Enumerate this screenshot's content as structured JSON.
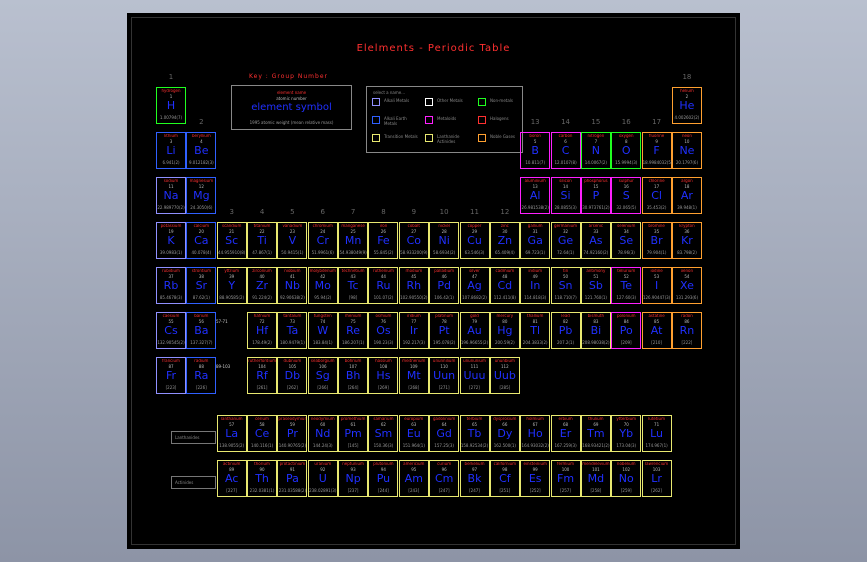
{
  "title": "Elelments - Periodic Table",
  "key": {
    "label": "Key : Group Number",
    "cell": {
      "name": "element name",
      "number": "atomic number",
      "symbol": "element symbol",
      "mass": "1995 atomic weight (mean relative mass)"
    },
    "legend_title": "select a name...",
    "legend": [
      {
        "label": "Alkali Metals",
        "color": "#9090ff"
      },
      {
        "label": "Other Metals",
        "color": "#ffffff"
      },
      {
        "label": "Non-metals",
        "color": "#20ff20"
      },
      {
        "label": "Alkali Earth Metals",
        "color": "#3060ff"
      },
      {
        "label": "Metaloids",
        "color": "#ff20ff"
      },
      {
        "label": "Halogens",
        "color": "#ff3030"
      },
      {
        "label": "Transition Metals",
        "color": "#e8e870"
      },
      {
        "label": "Lanthanide Actinides",
        "color": "#e8e870"
      },
      {
        "label": "Noble Gases",
        "color": "#ffa030"
      }
    ]
  },
  "groups": [
    "1",
    "2",
    "3",
    "4",
    "5",
    "6",
    "7",
    "8",
    "9",
    "10",
    "11",
    "12",
    "13",
    "14",
    "15",
    "16",
    "17",
    "18"
  ],
  "side_labels": [
    "57-71",
    "89-103"
  ],
  "buttons": {
    "lanthanide": "Lanthanides",
    "actinide": "Actinides"
  },
  "colors": {
    "alkali": "#9090ff",
    "alkaline": "#3060ff",
    "nonmetal": "#20ff20",
    "metalloid": "#ff20ff",
    "halogen": "#ff3030",
    "transition": "#e8e870",
    "noble": "#ffa030",
    "other": "#e8e870"
  },
  "elements": [
    {
      "n": "hydrogen",
      "z": "1",
      "s": "H",
      "m": "1.00794(7)",
      "r": 1,
      "c": 1,
      "t": "nonmetal"
    },
    {
      "n": "helium",
      "z": "2",
      "s": "He",
      "m": "4.002602(2)",
      "r": 1,
      "c": 18,
      "t": "noble"
    },
    {
      "n": "lithium",
      "z": "3",
      "s": "Li",
      "m": "6.941(2)",
      "r": 2,
      "c": 1,
      "t": "alkaline"
    },
    {
      "n": "beryllium",
      "z": "4",
      "s": "Be",
      "m": "9.012182(3)",
      "r": 2,
      "c": 2,
      "t": "alkaline"
    },
    {
      "n": "boron",
      "z": "5",
      "s": "B",
      "m": "10.811(7)",
      "r": 2,
      "c": 13,
      "t": "metalloid"
    },
    {
      "n": "carbon",
      "z": "6",
      "s": "C",
      "m": "12.0107(8)",
      "r": 2,
      "c": 14,
      "t": "metalloid"
    },
    {
      "n": "nitrogen",
      "z": "7",
      "s": "N",
      "m": "14.0067(2)",
      "r": 2,
      "c": 15,
      "t": "nonmetal"
    },
    {
      "n": "oxygen",
      "z": "8",
      "s": "O",
      "m": "15.9994(3)",
      "r": 2,
      "c": 16,
      "t": "nonmetal"
    },
    {
      "n": "fluorine",
      "z": "9",
      "s": "F",
      "m": "18.9984032(5)",
      "r": 2,
      "c": 17,
      "t": "noble"
    },
    {
      "n": "neon",
      "z": "10",
      "s": "Ne",
      "m": "20.1797(6)",
      "r": 2,
      "c": 18,
      "t": "noble"
    },
    {
      "n": "sodium",
      "z": "11",
      "s": "Na",
      "m": "22.989770(2)",
      "r": 3,
      "c": 1,
      "t": "alkali"
    },
    {
      "n": "magnesium",
      "z": "12",
      "s": "Mg",
      "m": "24.3050(6)",
      "r": 3,
      "c": 2,
      "t": "alkaline"
    },
    {
      "n": "aluminium",
      "z": "13",
      "s": "Al",
      "m": "26.981538(2)",
      "r": 3,
      "c": 13,
      "t": "metalloid"
    },
    {
      "n": "silicon",
      "z": "14",
      "s": "Si",
      "m": "28.0855(3)",
      "r": 3,
      "c": 14,
      "t": "metalloid"
    },
    {
      "n": "phosphorus",
      "z": "15",
      "s": "P",
      "m": "30.973761(2)",
      "r": 3,
      "c": 15,
      "t": "metalloid"
    },
    {
      "n": "sulphur",
      "z": "16",
      "s": "S",
      "m": "32.065(5)",
      "r": 3,
      "c": 16,
      "t": "metalloid"
    },
    {
      "n": "chlorine",
      "z": "17",
      "s": "Cl",
      "m": "35.453(2)",
      "r": 3,
      "c": 17,
      "t": "noble"
    },
    {
      "n": "argon",
      "z": "18",
      "s": "Ar",
      "m": "39.948(1)",
      "r": 3,
      "c": 18,
      "t": "noble"
    },
    {
      "n": "potassium",
      "z": "19",
      "s": "K",
      "m": "39.0983(1)",
      "r": 4,
      "c": 1,
      "t": "alkali"
    },
    {
      "n": "calcium",
      "z": "20",
      "s": "Ca",
      "m": "40.078(4)",
      "r": 4,
      "c": 2,
      "t": "alkaline"
    },
    {
      "n": "scandium",
      "z": "21",
      "s": "Sc",
      "m": "44.955910(8)",
      "r": 4,
      "c": 3,
      "t": "transition"
    },
    {
      "n": "titanium",
      "z": "22",
      "s": "Ti",
      "m": "47.867(1)",
      "r": 4,
      "c": 4,
      "t": "transition"
    },
    {
      "n": "vanadium",
      "z": "23",
      "s": "V",
      "m": "50.9415(1)",
      "r": 4,
      "c": 5,
      "t": "transition"
    },
    {
      "n": "chromium",
      "z": "24",
      "s": "Cr",
      "m": "51.9961(6)",
      "r": 4,
      "c": 6,
      "t": "transition"
    },
    {
      "n": "manganese",
      "z": "25",
      "s": "Mn",
      "m": "54.938049(9)",
      "r": 4,
      "c": 7,
      "t": "transition"
    },
    {
      "n": "iron",
      "z": "26",
      "s": "Fe",
      "m": "55.845(2)",
      "r": 4,
      "c": 8,
      "t": "transition"
    },
    {
      "n": "cobalt",
      "z": "27",
      "s": "Co",
      "m": "58.933200(9)",
      "r": 4,
      "c": 9,
      "t": "transition"
    },
    {
      "n": "nickel",
      "z": "28",
      "s": "Ni",
      "m": "58.6934(2)",
      "r": 4,
      "c": 10,
      "t": "transition"
    },
    {
      "n": "copper",
      "z": "29",
      "s": "Cu",
      "m": "63.546(3)",
      "r": 4,
      "c": 11,
      "t": "transition"
    },
    {
      "n": "zinc",
      "z": "30",
      "s": "Zn",
      "m": "65.409(4)",
      "r": 4,
      "c": 12,
      "t": "transition"
    },
    {
      "n": "gallium",
      "z": "31",
      "s": "Ga",
      "m": "69.723(1)",
      "r": 4,
      "c": 13,
      "t": "transition"
    },
    {
      "n": "germanium",
      "z": "32",
      "s": "Ge",
      "m": "72.64(1)",
      "r": 4,
      "c": 14,
      "t": "transition"
    },
    {
      "n": "arsenic",
      "z": "33",
      "s": "As",
      "m": "74.92160(2)",
      "r": 4,
      "c": 15,
      "t": "transition"
    },
    {
      "n": "selenium",
      "z": "34",
      "s": "Se",
      "m": "78.96(3)",
      "r": 4,
      "c": 16,
      "t": "transition"
    },
    {
      "n": "bromine",
      "z": "35",
      "s": "Br",
      "m": "79.904(1)",
      "r": 4,
      "c": 17,
      "t": "noble"
    },
    {
      "n": "krypton",
      "z": "36",
      "s": "Kr",
      "m": "83.798(2)",
      "r": 4,
      "c": 18,
      "t": "noble"
    },
    {
      "n": "rubidium",
      "z": "37",
      "s": "Rb",
      "m": "85.4678(3)",
      "r": 5,
      "c": 1,
      "t": "alkali"
    },
    {
      "n": "strontium",
      "z": "38",
      "s": "Sr",
      "m": "87.62(1)",
      "r": 5,
      "c": 2,
      "t": "alkaline"
    },
    {
      "n": "yttrium",
      "z": "39",
      "s": "Y",
      "m": "88.90585(2)",
      "r": 5,
      "c": 3,
      "t": "transition"
    },
    {
      "n": "zirconium",
      "z": "40",
      "s": "Zr",
      "m": "91.224(2)",
      "r": 5,
      "c": 4,
      "t": "transition"
    },
    {
      "n": "niobium",
      "z": "41",
      "s": "Nb",
      "m": "92.90638(2)",
      "r": 5,
      "c": 5,
      "t": "transition"
    },
    {
      "n": "molybdenum",
      "z": "42",
      "s": "Mo",
      "m": "95.94(2)",
      "r": 5,
      "c": 6,
      "t": "transition"
    },
    {
      "n": "technetium",
      "z": "43",
      "s": "Tc",
      "m": "[98]",
      "r": 5,
      "c": 7,
      "t": "transition"
    },
    {
      "n": "ruthenium",
      "z": "44",
      "s": "Ru",
      "m": "101.07(2)",
      "r": 5,
      "c": 8,
      "t": "transition"
    },
    {
      "n": "rhodium",
      "z": "45",
      "s": "Rh",
      "m": "102.90550(2)",
      "r": 5,
      "c": 9,
      "t": "transition"
    },
    {
      "n": "palladium",
      "z": "46",
      "s": "Pd",
      "m": "106.42(1)",
      "r": 5,
      "c": 10,
      "t": "transition"
    },
    {
      "n": "silver",
      "z": "47",
      "s": "Ag",
      "m": "107.8682(2)",
      "r": 5,
      "c": 11,
      "t": "transition"
    },
    {
      "n": "cadmium",
      "z": "48",
      "s": "Cd",
      "m": "112.411(8)",
      "r": 5,
      "c": 12,
      "t": "transition"
    },
    {
      "n": "indium",
      "z": "49",
      "s": "In",
      "m": "114.818(3)",
      "r": 5,
      "c": 13,
      "t": "transition"
    },
    {
      "n": "tin",
      "z": "50",
      "s": "Sn",
      "m": "118.710(7)",
      "r": 5,
      "c": 14,
      "t": "transition"
    },
    {
      "n": "antimony",
      "z": "51",
      "s": "Sb",
      "m": "121.760(1)",
      "r": 5,
      "c": 15,
      "t": "transition"
    },
    {
      "n": "tellurium",
      "z": "52",
      "s": "Te",
      "m": "127.60(3)",
      "r": 5,
      "c": 16,
      "t": "metalloid"
    },
    {
      "n": "iodine",
      "z": "53",
      "s": "I",
      "m": "126.90447(3)",
      "r": 5,
      "c": 17,
      "t": "noble"
    },
    {
      "n": "xenon",
      "z": "54",
      "s": "Xe",
      "m": "131.293(6)",
      "r": 5,
      "c": 18,
      "t": "noble"
    },
    {
      "n": "caesium",
      "z": "55",
      "s": "Cs",
      "m": "132.90545(2)",
      "r": 6,
      "c": 1,
      "t": "alkali"
    },
    {
      "n": "barium",
      "z": "56",
      "s": "Ba",
      "m": "137.327(7)",
      "r": 6,
      "c": 2,
      "t": "alkaline"
    },
    {
      "n": "hafnium",
      "z": "72",
      "s": "Hf",
      "m": "178.49(2)",
      "r": 6,
      "c": 4,
      "t": "transition"
    },
    {
      "n": "tantalum",
      "z": "73",
      "s": "Ta",
      "m": "180.9479(1)",
      "r": 6,
      "c": 5,
      "t": "transition"
    },
    {
      "n": "tungsten",
      "z": "74",
      "s": "W",
      "m": "183.84(1)",
      "r": 6,
      "c": 6,
      "t": "transition"
    },
    {
      "n": "rhenium",
      "z": "75",
      "s": "Re",
      "m": "186.207(1)",
      "r": 6,
      "c": 7,
      "t": "transition"
    },
    {
      "n": "osmium",
      "z": "76",
      "s": "Os",
      "m": "190.23(3)",
      "r": 6,
      "c": 8,
      "t": "transition"
    },
    {
      "n": "iridium",
      "z": "77",
      "s": "Ir",
      "m": "192.217(3)",
      "r": 6,
      "c": 9,
      "t": "transition"
    },
    {
      "n": "platinum",
      "z": "78",
      "s": "Pt",
      "m": "195.078(2)",
      "r": 6,
      "c": 10,
      "t": "transition"
    },
    {
      "n": "gold",
      "z": "79",
      "s": "Au",
      "m": "196.96655(2)",
      "r": 6,
      "c": 11,
      "t": "transition"
    },
    {
      "n": "mercury",
      "z": "80",
      "s": "Hg",
      "m": "200.59(2)",
      "r": 6,
      "c": 12,
      "t": "transition"
    },
    {
      "n": "thallium",
      "z": "81",
      "s": "Tl",
      "m": "204.3833(2)",
      "r": 6,
      "c": 13,
      "t": "transition"
    },
    {
      "n": "lead",
      "z": "82",
      "s": "Pb",
      "m": "207.2(1)",
      "r": 6,
      "c": 14,
      "t": "transition"
    },
    {
      "n": "bismuth",
      "z": "83",
      "s": "Bi",
      "m": "208.98038(2)",
      "r": 6,
      "c": 15,
      "t": "transition"
    },
    {
      "n": "polonium",
      "z": "84",
      "s": "Po",
      "m": "[209]",
      "r": 6,
      "c": 16,
      "t": "metalloid"
    },
    {
      "n": "astatine",
      "z": "85",
      "s": "At",
      "m": "[210]",
      "r": 6,
      "c": 17,
      "t": "noble"
    },
    {
      "n": "radon",
      "z": "86",
      "s": "Rn",
      "m": "[222]",
      "r": 6,
      "c": 18,
      "t": "noble"
    },
    {
      "n": "francium",
      "z": "87",
      "s": "Fr",
      "m": "[223]",
      "r": 7,
      "c": 1,
      "t": "alkali"
    },
    {
      "n": "radium",
      "z": "88",
      "s": "Ra",
      "m": "[226]",
      "r": 7,
      "c": 2,
      "t": "alkaline"
    },
    {
      "n": "rutherfordium",
      "z": "104",
      "s": "Rf",
      "m": "[261]",
      "r": 7,
      "c": 4,
      "t": "transition"
    },
    {
      "n": "dubnium",
      "z": "105",
      "s": "Db",
      "m": "[262]",
      "r": 7,
      "c": 5,
      "t": "transition"
    },
    {
      "n": "seaborgium",
      "z": "106",
      "s": "Sg",
      "m": "[266]",
      "r": 7,
      "c": 6,
      "t": "transition"
    },
    {
      "n": "bohrium",
      "z": "107",
      "s": "Bh",
      "m": "[264]",
      "r": 7,
      "c": 7,
      "t": "transition"
    },
    {
      "n": "hassium",
      "z": "108",
      "s": "Hs",
      "m": "[269]",
      "r": 7,
      "c": 8,
      "t": "transition"
    },
    {
      "n": "meitnerium",
      "z": "109",
      "s": "Mt",
      "m": "[268]",
      "r": 7,
      "c": 9,
      "t": "transition"
    },
    {
      "n": "ununnilium",
      "z": "110",
      "s": "Uun",
      "m": "[271]",
      "r": 7,
      "c": 10,
      "t": "transition"
    },
    {
      "n": "unununium",
      "z": "111",
      "s": "Uuu",
      "m": "[272]",
      "r": 7,
      "c": 11,
      "t": "transition"
    },
    {
      "n": "ununbium",
      "z": "112",
      "s": "Uub",
      "m": "[285]",
      "r": 7,
      "c": 12,
      "t": "transition"
    },
    {
      "n": "lanthanum",
      "z": "57",
      "s": "La",
      "m": "138.9055(2)",
      "r": 9,
      "c": 3,
      "t": "other"
    },
    {
      "n": "cerium",
      "z": "58",
      "s": "Ce",
      "m": "140.116(1)",
      "r": 9,
      "c": 4,
      "t": "other"
    },
    {
      "n": "praseodymium",
      "z": "59",
      "s": "Pr",
      "m": "140.90765(2)",
      "r": 9,
      "c": 5,
      "t": "other"
    },
    {
      "n": "neodymium",
      "z": "60",
      "s": "Nd",
      "m": "144.24(3)",
      "r": 9,
      "c": 6,
      "t": "other"
    },
    {
      "n": "promethium",
      "z": "61",
      "s": "Pm",
      "m": "[145]",
      "r": 9,
      "c": 7,
      "t": "other"
    },
    {
      "n": "samarium",
      "z": "62",
      "s": "Sm",
      "m": "150.36(3)",
      "r": 9,
      "c": 8,
      "t": "other"
    },
    {
      "n": "europium",
      "z": "63",
      "s": "Eu",
      "m": "151.964(1)",
      "r": 9,
      "c": 9,
      "t": "other"
    },
    {
      "n": "gadolinium",
      "z": "64",
      "s": "Gd",
      "m": "157.25(3)",
      "r": 9,
      "c": 10,
      "t": "other"
    },
    {
      "n": "terbium",
      "z": "65",
      "s": "Tb",
      "m": "158.92534(2)",
      "r": 9,
      "c": 11,
      "t": "other"
    },
    {
      "n": "dysprosium",
      "z": "66",
      "s": "Dy",
      "m": "162.500(1)",
      "r": 9,
      "c": 12,
      "t": "other"
    },
    {
      "n": "holmium",
      "z": "67",
      "s": "Ho",
      "m": "164.93032(2)",
      "r": 9,
      "c": 13,
      "t": "other"
    },
    {
      "n": "erbium",
      "z": "68",
      "s": "Er",
      "m": "167.259(3)",
      "r": 9,
      "c": 14,
      "t": "other"
    },
    {
      "n": "thulium",
      "z": "69",
      "s": "Tm",
      "m": "168.93421(2)",
      "r": 9,
      "c": 15,
      "t": "other"
    },
    {
      "n": "ytterbium",
      "z": "70",
      "s": "Yb",
      "m": "173.04(3)",
      "r": 9,
      "c": 16,
      "t": "other"
    },
    {
      "n": "lutetium",
      "z": "71",
      "s": "Lu",
      "m": "174.967(1)",
      "r": 9,
      "c": 17,
      "t": "other"
    },
    {
      "n": "actinium",
      "z": "89",
      "s": "Ac",
      "m": "[227]",
      "r": 10,
      "c": 3,
      "t": "other"
    },
    {
      "n": "thorium",
      "z": "90",
      "s": "Th",
      "m": "232.0381(1)",
      "r": 10,
      "c": 4,
      "t": "other"
    },
    {
      "n": "protactinium",
      "z": "91",
      "s": "Pa",
      "m": "231.03588(2)",
      "r": 10,
      "c": 5,
      "t": "other"
    },
    {
      "n": "uranium",
      "z": "92",
      "s": "U",
      "m": "238.02891(3)",
      "r": 10,
      "c": 6,
      "t": "other"
    },
    {
      "n": "neptunium",
      "z": "93",
      "s": "Np",
      "m": "[237]",
      "r": 10,
      "c": 7,
      "t": "other"
    },
    {
      "n": "plutonium",
      "z": "94",
      "s": "Pu",
      "m": "[244]",
      "r": 10,
      "c": 8,
      "t": "other"
    },
    {
      "n": "americium",
      "z": "95",
      "s": "Am",
      "m": "[243]",
      "r": 10,
      "c": 9,
      "t": "other"
    },
    {
      "n": "curium",
      "z": "96",
      "s": "Cm",
      "m": "[247]",
      "r": 10,
      "c": 10,
      "t": "other"
    },
    {
      "n": "berkelium",
      "z": "97",
      "s": "Bk",
      "m": "[247]",
      "r": 10,
      "c": 11,
      "t": "other"
    },
    {
      "n": "californium",
      "z": "98",
      "s": "Cf",
      "m": "[251]",
      "r": 10,
      "c": 12,
      "t": "other"
    },
    {
      "n": "einsteinium",
      "z": "99",
      "s": "Es",
      "m": "[252]",
      "r": 10,
      "c": 13,
      "t": "other"
    },
    {
      "n": "fermium",
      "z": "100",
      "s": "Fm",
      "m": "[257]",
      "r": 10,
      "c": 14,
      "t": "other"
    },
    {
      "n": "mendelevium",
      "z": "101",
      "s": "Md",
      "m": "[258]",
      "r": 10,
      "c": 15,
      "t": "other"
    },
    {
      "n": "nobelium",
      "z": "102",
      "s": "No",
      "m": "[259]",
      "r": 10,
      "c": 16,
      "t": "other"
    },
    {
      "n": "lawrencium",
      "z": "103",
      "s": "Lr",
      "m": "[262]",
      "r": 10,
      "c": 17,
      "t": "other"
    }
  ]
}
